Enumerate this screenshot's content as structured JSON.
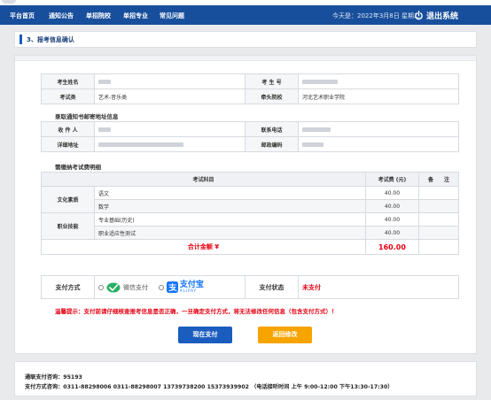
{
  "nav": {
    "items": [
      "平台首页",
      "通知公告",
      "单招院校",
      "单招专业",
      "常见问题"
    ],
    "today": "今天是：2022年3月8日 星期二",
    "logout": "退出系统"
  },
  "step": {
    "title": "3、报考信息确认"
  },
  "applicant": {
    "name_label": "考生姓名",
    "exam_no_label": "考 生 号",
    "category_label": "考试类",
    "category_value": "艺术-音乐类",
    "school_label": "牵头院校",
    "school_value": "河北艺术职业学院"
  },
  "mail": {
    "heading": "录取通知书邮寄地址信息",
    "recipient_label": "收 件 人",
    "phone_label": "联系电话",
    "address_label": "详细地址",
    "postcode_label": "邮政编码"
  },
  "fees": {
    "heading": "需缴纳考试费明细",
    "headers": {
      "subject": "考试科目",
      "fee": "考试费 (元)",
      "remark": "备　　注"
    },
    "groups": [
      {
        "name": "文化素质",
        "rows": [
          {
            "subject": "语文",
            "fee": "40.00"
          },
          {
            "subject": "数学",
            "fee": "40.00"
          }
        ]
      },
      {
        "name": "职业技能",
        "rows": [
          {
            "subject": "专业基础(历史)",
            "fee": "40.00"
          },
          {
            "subject": "职业适应性测试",
            "fee": "40.00"
          }
        ]
      }
    ],
    "total_label": "合计金额 ¥",
    "total_value": "160.00"
  },
  "payment": {
    "method_label": "支付方式",
    "wechat": "微信支付",
    "alipay": "支付宝",
    "alipay_sub": "ALIPAY",
    "status_label": "支付状态",
    "status_value": "未支付"
  },
  "tip": "温馨提示：支付前请仔细核查报考信息是否正确，一旦确定支付方式，将无法修改任何信息（包含支付方式）！",
  "buttons": {
    "pay": "现在支付",
    "back": "返回修改"
  },
  "footer": {
    "line1": "通联支付咨询：95193",
    "line2": "支付方式咨询：0311-88298006 0311-88298007 13739738200 15373939902 （电话接听时间 上午 9:00-12:00 下午13:30-17:30）"
  },
  "colors": {
    "nav": "#184f9c",
    "accent": "#1b5dbf",
    "alert": "#e60012",
    "back_button": "#f7a400",
    "wechat": "#2aae67",
    "alipay": "#1677ff"
  }
}
